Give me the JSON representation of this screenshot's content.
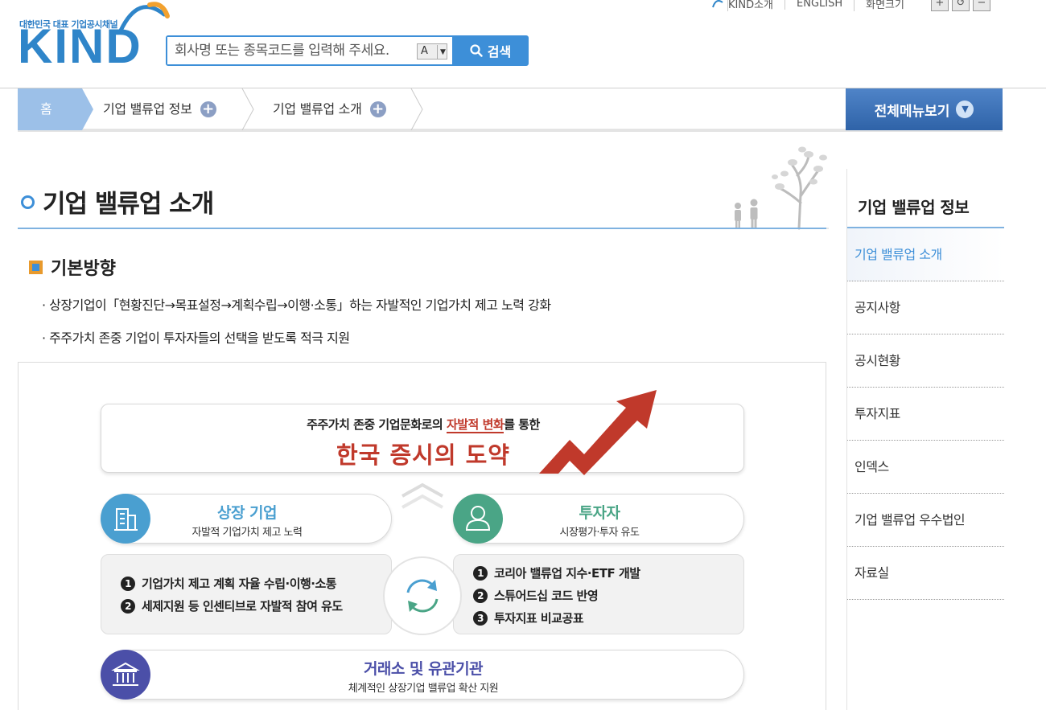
{
  "header": {
    "logo_tagline": "대한민국 대표 기업공시채널",
    "logo_text": "KIND",
    "search": {
      "placeholder": "회사명 또는 종목코드를 입력해 주세요.",
      "font_option": "A",
      "button_label": "검색"
    },
    "util_links": [
      "KIND소개",
      "ENGLISH",
      "화면크기"
    ],
    "zoom_buttons": [
      "+",
      "↺",
      "−"
    ]
  },
  "breadcrumb": {
    "home": "홈",
    "crumbs": [
      "기업 밸류업 정보",
      "기업 밸류업 소개"
    ],
    "all_menu_label": "전체메뉴보기"
  },
  "main": {
    "page_title": "기업 밸류업 소개",
    "section_heading": "기본방향",
    "bullets": [
      "· 상장기업이「현황진단→목표설정→계획수립→이행·소통」하는 자발적인 기업가치 제고 노력 강화",
      "· 주주가치 존중 기업이 투자자들의 선택을 받도록 적극 지원"
    ]
  },
  "diagram": {
    "top_line1_a": "주주가치 존중 기업문화로의 ",
    "top_line1_highlight": "자발적 변화",
    "top_line1_b": "를 통한",
    "top_line2": "한국 증시의 도약",
    "companies": {
      "title": "상장 기업",
      "subtitle": "자발적 기업가치 제고 노력",
      "items": [
        "기업가치 제고 계획 자율 수립·이행·소통",
        "세제지원 등 인센티브로 자발적 참여 유도"
      ]
    },
    "investors": {
      "title": "투자자",
      "subtitle": "시장평가·투자 유도",
      "items": [
        "코리아 밸류업 지수·ETF 개발",
        "스튜어드십 코드 반영",
        "투자지표 비교공표"
      ]
    },
    "exchange": {
      "title": "거래소 및 유관기관",
      "subtitle": "체계적인 상장기업 밸류업 확산 지원"
    },
    "colors": {
      "accent_red": "#c0392b",
      "company_blue": "#4a9fd0",
      "investor_green": "#4aa586",
      "exchange_purple": "#4b4fa8"
    }
  },
  "sidebar": {
    "title": "기업 밸류업 정보",
    "items": [
      "기업 밸류업 소개",
      "공지사항",
      "공시현황",
      "투자지표",
      "인덱스",
      "기업 밸류업 우수법인",
      "자료실"
    ]
  }
}
